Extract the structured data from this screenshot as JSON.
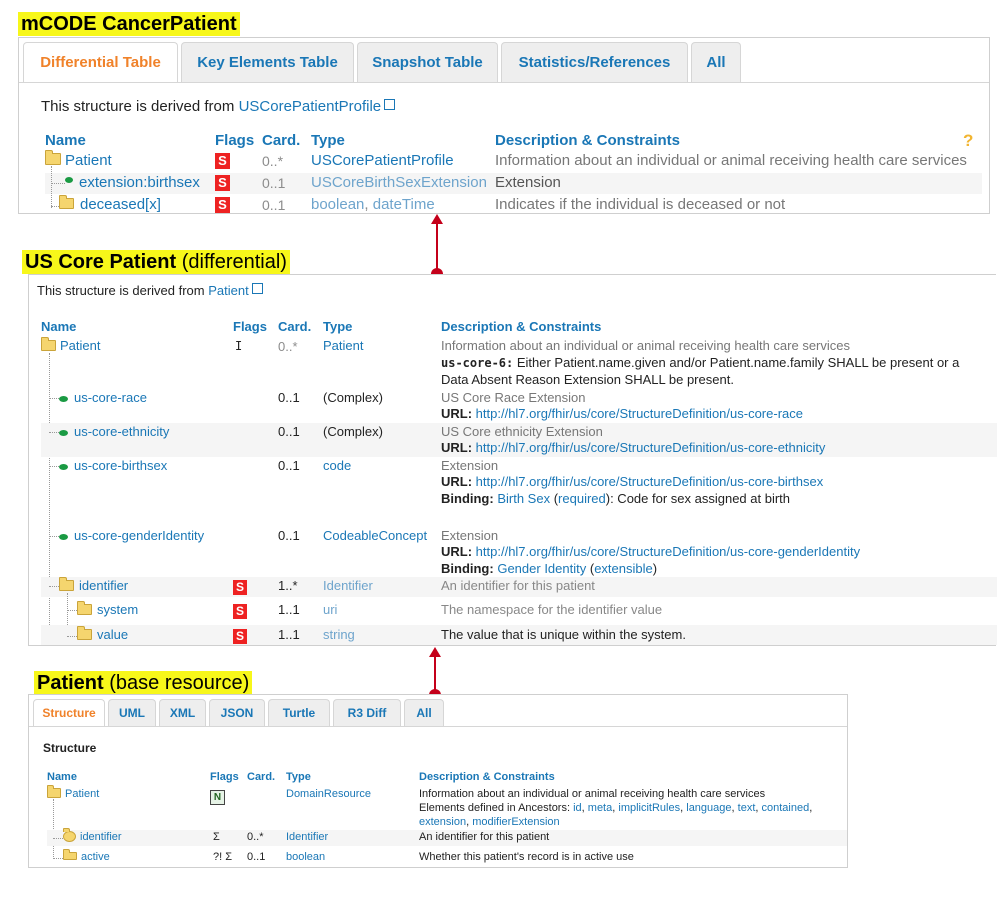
{
  "mcode": {
    "title": "mCODE CancerPatient",
    "tabs": [
      "Differential Table",
      "Key Elements Table",
      "Snapshot Table",
      "Statistics/References",
      "All"
    ],
    "derived_prefix": "This structure is derived from ",
    "derived_link": "USCorePatientProfile",
    "headers": {
      "name": "Name",
      "flags": "Flags",
      "card": "Card.",
      "type": "Type",
      "desc": "Description & Constraints",
      "help": "?"
    },
    "rows": [
      {
        "name": "Patient",
        "flag": "S",
        "card": "0..*",
        "type": "USCorePatientProfile",
        "desc": "Information about an individual or animal receiving health care services"
      },
      {
        "name": "extension:birthsex",
        "flag": "S",
        "card": "0..1",
        "type": "USCoreBirthSexExtension",
        "desc": "Extension"
      },
      {
        "name": "deceased[x]",
        "flag": "S",
        "card": "0..1",
        "type1": "boolean",
        "type_sep": ", ",
        "type2": "dateTime",
        "desc": "Indicates if the individual is deceased or not"
      }
    ]
  },
  "uscore": {
    "title": "US Core Patient",
    "subtitle": " (differential)",
    "derived_prefix": "This structure is derived from ",
    "derived_link": "Patient",
    "headers": {
      "name": "Name",
      "flags": "Flags",
      "card": "Card.",
      "type": "Type",
      "desc": "Description & Constraints"
    },
    "patient": {
      "name": "Patient",
      "flag": "I",
      "card": "0..*",
      "type": "Patient",
      "desc": "Information about an individual or animal receiving health care services",
      "inv_label": "us-core-6:",
      "inv_text": " Either Patient.name.given and/or Patient.name.family SHALL be present or a",
      "inv_text2": "Data Absent Reason Extension SHALL be present."
    },
    "race": {
      "name": "us-core-race",
      "card": "0..1",
      "type": "(Complex)",
      "desc": "US Core Race Extension",
      "url_label": "URL:",
      "url": "http://hl7.org/fhir/us/core/StructureDefinition/us-core-race"
    },
    "ethnicity": {
      "name": "us-core-ethnicity",
      "card": "0..1",
      "type": "(Complex)",
      "desc": "US Core ethnicity Extension",
      "url_label": "URL:",
      "url": "http://hl7.org/fhir/us/core/StructureDefinition/us-core-ethnicity"
    },
    "birthsex": {
      "name": "us-core-birthsex",
      "card": "0..1",
      "type": "code",
      "desc": "Extension",
      "url_label": "URL:",
      "url": "http://hl7.org/fhir/us/core/StructureDefinition/us-core-birthsex",
      "binding_label": "Binding:",
      "binding_link": "Birth Sex",
      "binding_paren_open": " (",
      "binding_strength": "required",
      "binding_rest": "): Code for sex assigned at birth"
    },
    "gender": {
      "name": "us-core-genderIdentity",
      "card": "0..1",
      "type": "CodeableConcept",
      "desc": "Extension",
      "url_label": "URL:",
      "url": "http://hl7.org/fhir/us/core/StructureDefinition/us-core-genderIdentity",
      "binding_label": "Binding:",
      "binding_link": "Gender Identity",
      "binding_paren_open": " (",
      "binding_strength": "extensible",
      "binding_close": ")"
    },
    "identifier": {
      "name": "identifier",
      "flag": "S",
      "card": "1..*",
      "type": "Identifier",
      "desc": "An identifier for this patient"
    },
    "system": {
      "name": "system",
      "flag": "S",
      "card": "1..1",
      "type": "uri",
      "desc": "The namespace for the identifier value"
    },
    "value": {
      "name": "value",
      "flag": "S",
      "card": "1..1",
      "type": "string",
      "desc": "The value that is unique within the system."
    }
  },
  "base": {
    "title": "Patient",
    "subtitle": " (base resource)",
    "tabs": [
      "Structure",
      "UML",
      "XML",
      "JSON",
      "Turtle",
      "R3 Diff",
      "All"
    ],
    "section": "Structure",
    "headers": {
      "name": "Name",
      "flags": "Flags",
      "card": "Card.",
      "type": "Type",
      "desc": "Description & Constraints"
    },
    "patient": {
      "name": "Patient",
      "flag": "N",
      "type": "DomainResource",
      "desc": "Information about an individual or animal receiving health care services",
      "anc_prefix": "Elements defined in Ancestors: ",
      "anc": [
        "id",
        "meta",
        "implicitRules",
        "language",
        "text",
        "contained"
      ],
      "anc2": [
        "extension",
        "modifierExtension"
      ]
    },
    "identifier": {
      "name": "identifier",
      "flag": "Σ",
      "card": "0..*",
      "type": "Identifier",
      "desc": "An identifier for this patient"
    },
    "active": {
      "name": "active",
      "flag": "?! Σ",
      "card": "0..1",
      "type": "boolean",
      "desc": "Whether this patient's record is in active use"
    }
  },
  "colors": {
    "link": "#1a77b6",
    "active_tab": "#f0822a",
    "flag_s": "#e22222",
    "highlight": "#f7f71a",
    "arrow": "#c4001a"
  }
}
